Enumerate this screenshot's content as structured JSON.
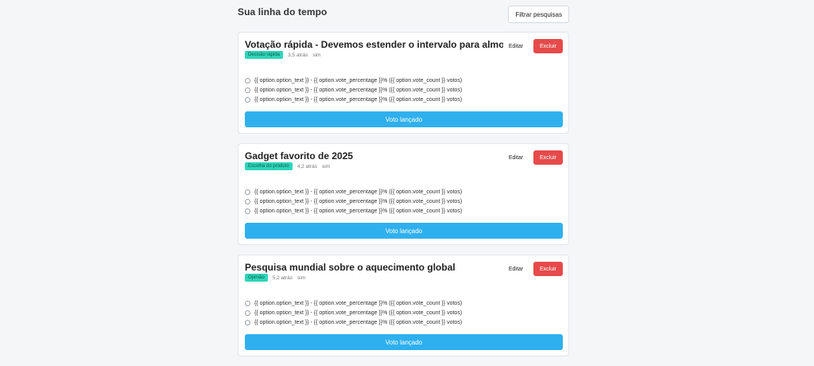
{
  "header": {
    "title": "Sua linha do tempo",
    "filter_label": "Filtrar pesquisas"
  },
  "colors": {
    "vote_button": "#2fb0ee",
    "delete_button": "#e64a4a",
    "tag": "#2fd5b9"
  },
  "polls": [
    {
      "title": "Votação rápida - Devemos estender o intervalo para almoço?",
      "tag": "Decisão rápida",
      "time_ago": "3,5 atrás",
      "extra": "sim",
      "edit_label": "Editar",
      "delete_label": "Excluir",
      "options": [
        "{{ option.option_text }} - {{ option.vote_percentage }}% ({{ option.vote_count }} votos)",
        "{{ option.option_text }} - {{ option.vote_percentage }}% ({{ option.vote_count }} votos)",
        "{{ option.option_text }} - {{ option.vote_percentage }}% ({{ option.vote_count }} votos)"
      ],
      "vote_label": "Voto lançado"
    },
    {
      "title": "Gadget favorito de 2025",
      "tag": "Escolha do produto",
      "time_ago": "4,2 atrás",
      "extra": "sim",
      "edit_label": "Editar",
      "delete_label": "Excluir",
      "options": [
        "{{ option.option_text }} - {{ option.vote_percentage }}% ({{ option.vote_count }} votos)",
        "{{ option.option_text }} - {{ option.vote_percentage }}% ({{ option.vote_count }} votos)",
        "{{ option.option_text }} - {{ option.vote_percentage }}% ({{ option.vote_count }} votos)"
      ],
      "vote_label": "Voto lançado"
    },
    {
      "title": "Pesquisa mundial sobre o aquecimento global",
      "tag": "Opinião",
      "time_ago": "5,2 atrás",
      "extra": "sim",
      "edit_label": "Editar",
      "delete_label": "Excluir",
      "options": [
        "{{ option.option_text }} - {{ option.vote_percentage }}% ({{ option.vote_count }} votos)",
        "{{ option.option_text }} - {{ option.vote_percentage }}% ({{ option.vote_count }} votos)",
        "{{ option.option_text }} - {{ option.vote_percentage }}% ({{ option.vote_count }} votos)"
      ],
      "vote_label": "Voto lançado"
    }
  ]
}
